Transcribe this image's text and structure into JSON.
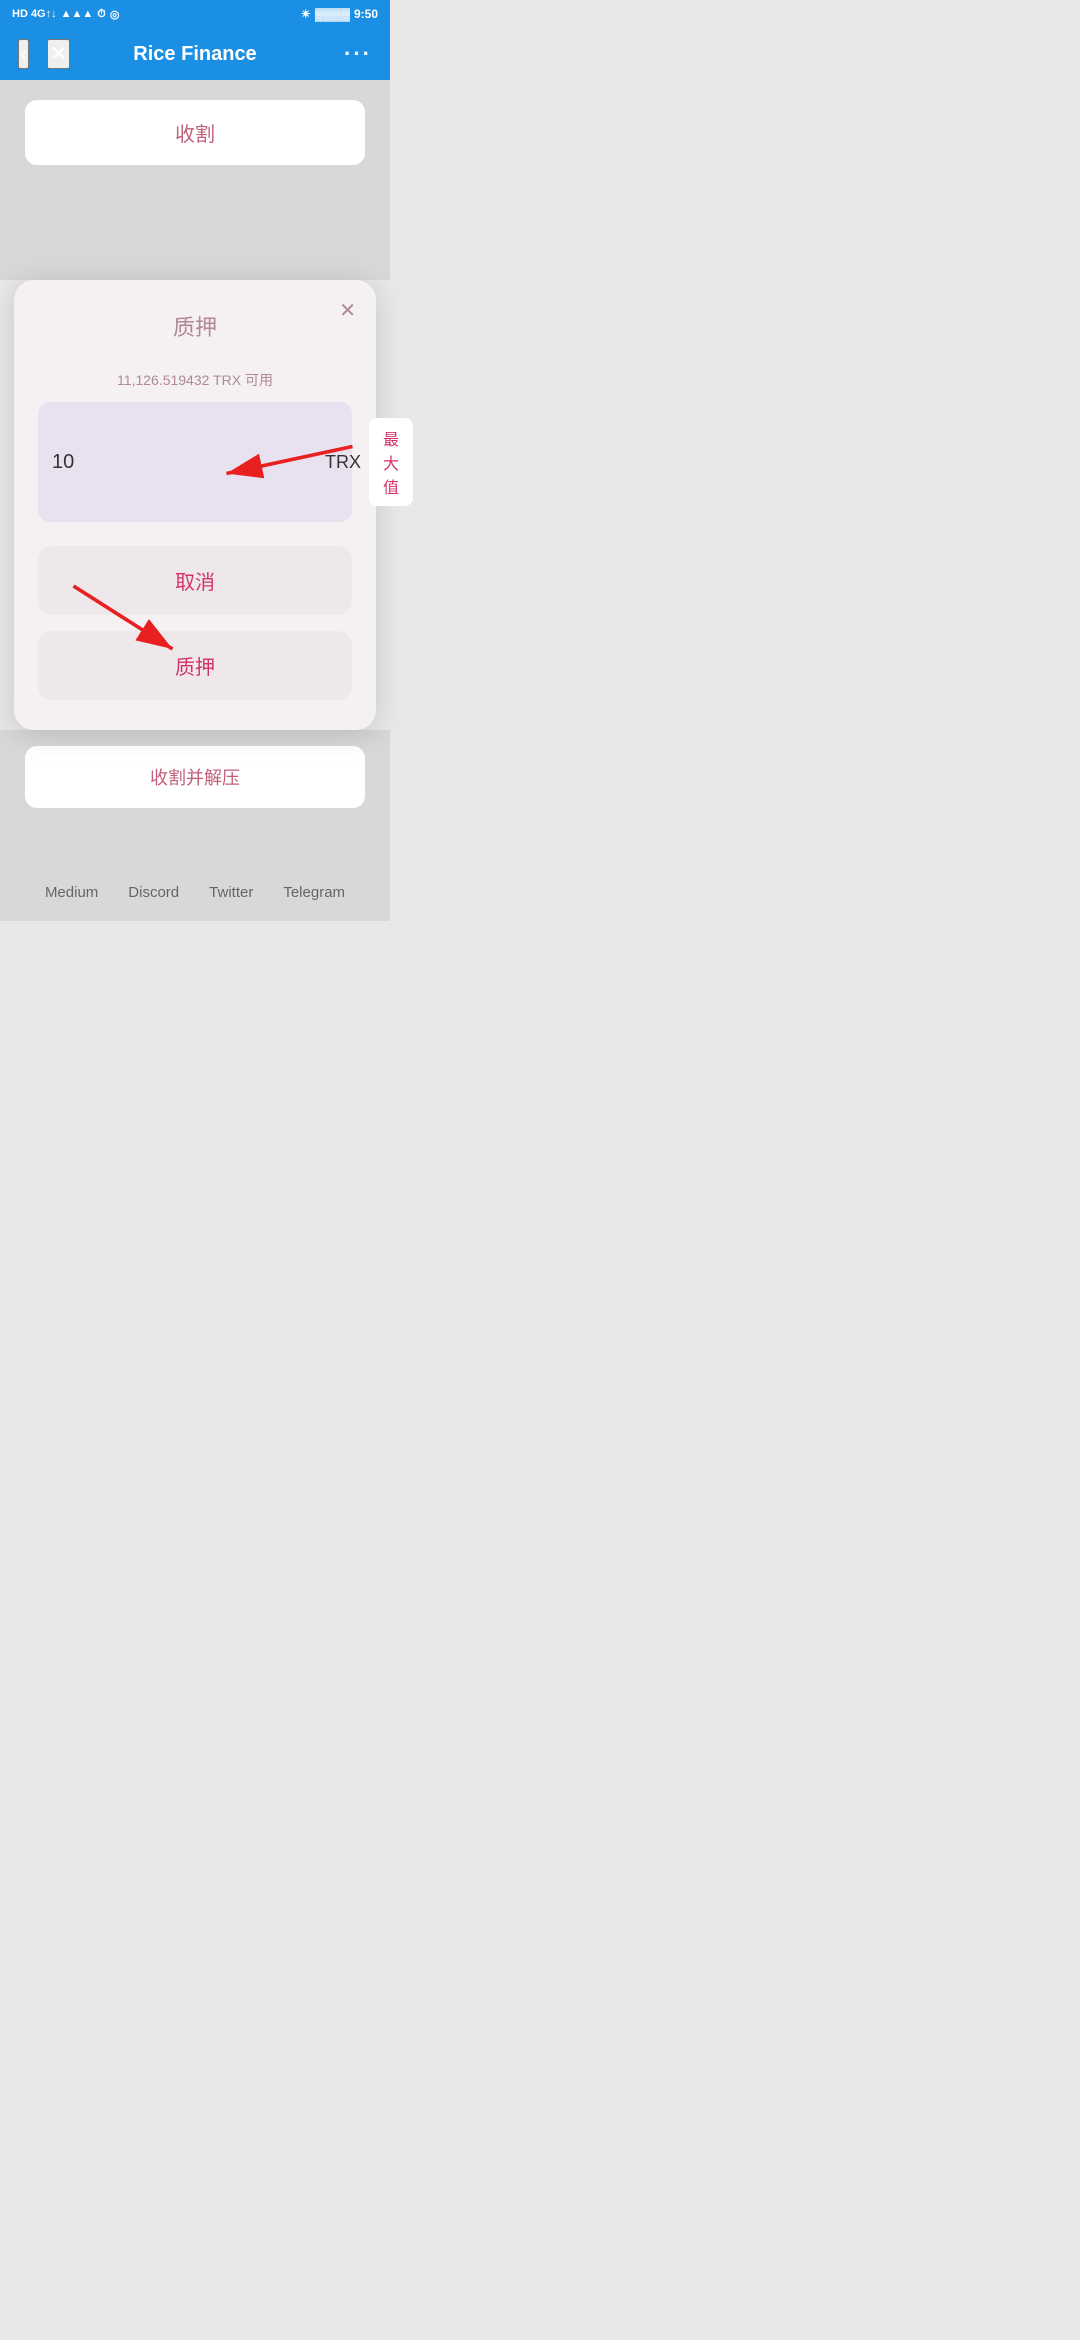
{
  "statusBar": {
    "left": "HD 4G",
    "time": "9:50",
    "bluetooth": "⚡",
    "battery": "🔋"
  },
  "navBar": {
    "title": "Rice Finance",
    "backLabel": "‹",
    "closeLabel": "✕",
    "moreLabel": "···"
  },
  "bgButtons": {
    "harvestLabel": "收割"
  },
  "modal": {
    "closeLabel": "✕",
    "title": "质押",
    "availableText": "11,126.519432 TRX 可用",
    "inputValue": "10",
    "currencyLabel": "TRX",
    "maxLabel": "最大值",
    "cancelLabel": "取消",
    "pledgeLabel": "质押"
  },
  "bottomButtons": {
    "harvestDecompressLabel": "收割并解压"
  },
  "footer": {
    "links": [
      "Medium",
      "Discord",
      "Twitter",
      "Telegram"
    ]
  }
}
